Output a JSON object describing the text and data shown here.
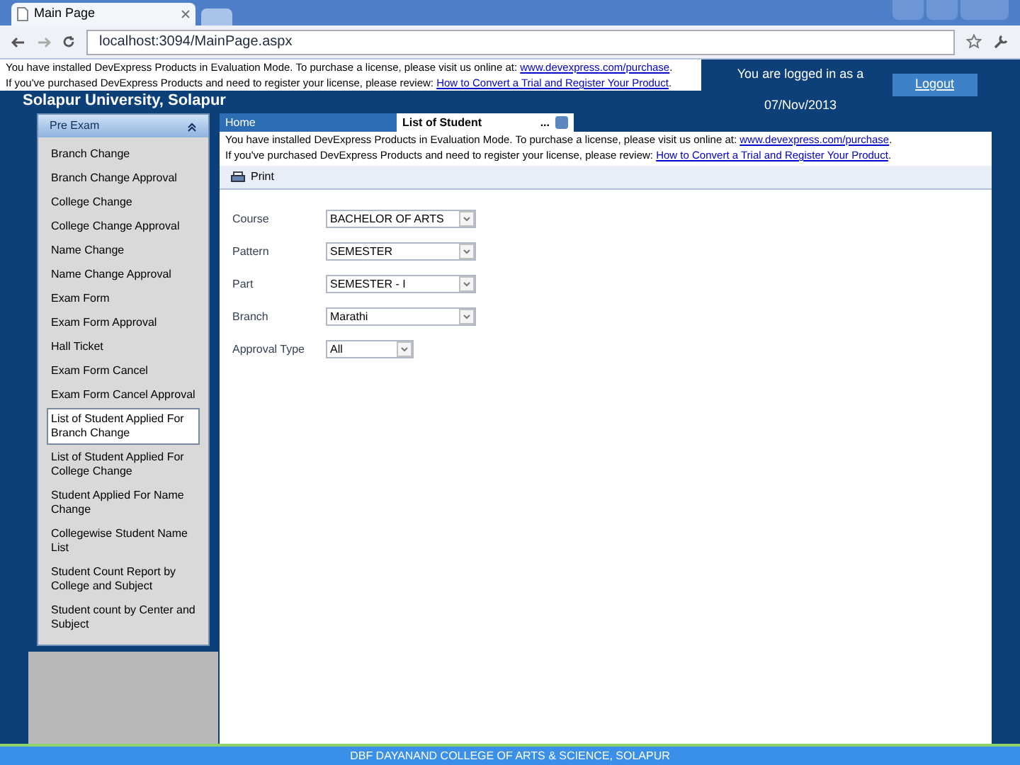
{
  "browser": {
    "tab_title": "Main Page",
    "url": "localhost:3094/MainPage.aspx"
  },
  "eval_notices": [
    {
      "lines": [
        {
          "text": "You have installed DevExpress Products in Evaluation Mode. To purchase a license, please visit us online at: ",
          "link": "www.devexpress.com/purchase",
          "after": "."
        },
        {
          "text": "If you've purchased DevExpress Products and need to register your license, please review: ",
          "link": "How to Convert a Trial and Register Your Product",
          "after": "."
        }
      ]
    },
    {
      "lines": [
        {
          "text": "You have installed DevExpress Products in Evaluation Mode. To purchase a license, please visit us online at: ",
          "link": "www.devexpress.com/purchase",
          "after": "."
        },
        {
          "text": "If you've purchased DevExpress Products and need to register your license, please review: ",
          "link": "How to Convert a Trial and Register Your Product",
          "after": "."
        }
      ]
    }
  ],
  "header": {
    "title": "Solapur University, Solapur",
    "logged_in": "You are logged in as a",
    "date": "07/Nov/2013",
    "logout": "Logout"
  },
  "sidebar": {
    "group": "Pre Exam",
    "expanded": true,
    "items": [
      {
        "label": "Branch Change",
        "selected": false
      },
      {
        "label": "Branch Change Approval",
        "selected": false
      },
      {
        "label": "College Change",
        "selected": false
      },
      {
        "label": "College Change Approval",
        "selected": false
      },
      {
        "label": "Name Change",
        "selected": false
      },
      {
        "label": "Name Change Approval",
        "selected": false
      },
      {
        "label": "Exam Form",
        "selected": false
      },
      {
        "label": "Exam Form Approval",
        "selected": false
      },
      {
        "label": "Hall Ticket",
        "selected": false
      },
      {
        "label": "Exam Form Cancel",
        "selected": false
      },
      {
        "label": "Exam Form Cancel Approval",
        "selected": false
      },
      {
        "label": "List of Student Applied For Branch Change",
        "selected": true
      },
      {
        "label": "List of Student Applied For College Change",
        "selected": false
      },
      {
        "label": "Student Applied For Name Change",
        "selected": false
      },
      {
        "label": "Collegewise Student Name List",
        "selected": false
      },
      {
        "label": "Student Count Report by College and Subject",
        "selected": false
      },
      {
        "label": "Student count by Center and Subject",
        "selected": false
      }
    ]
  },
  "tabs": [
    {
      "label": "Home",
      "selected": false
    },
    {
      "label": "List of Student",
      "more": "...",
      "selected": true
    }
  ],
  "toolbar": {
    "print": "Print"
  },
  "form": [
    {
      "label": "Course",
      "value": "BACHELOR OF ARTS"
    },
    {
      "label": "Pattern",
      "value": "SEMESTER"
    },
    {
      "label": "Part",
      "value": "SEMESTER - I"
    },
    {
      "label": "Branch",
      "value": "Marathi"
    },
    {
      "label": "Approval Type",
      "value": "All",
      "kind": "short"
    }
  ],
  "footer": "DBF DAYANAND COLLEGE OF ARTS & SCIENCE, SOLAPUR"
}
